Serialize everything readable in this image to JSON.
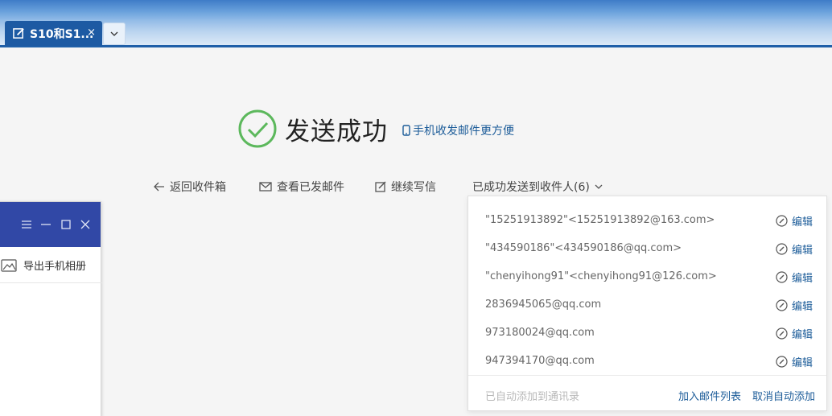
{
  "tab": {
    "title": "S10和S1...",
    "close": "×"
  },
  "success": {
    "title": "发送成功",
    "mobile_link": "手机收发邮件更方便"
  },
  "actions": {
    "back": "返回收件箱",
    "view_sent": "查看已发邮件",
    "continue": "继续写信",
    "recipients": "已成功发送到收件人(6)"
  },
  "recipients": [
    {
      "address": "\"15251913892\"<15251913892@163.com>",
      "edit": "编辑"
    },
    {
      "address": "\"434590186\"<434590186@qq.com>",
      "edit": "编辑"
    },
    {
      "address": "\"chenyihong91\"<chenyihong91@126.com>",
      "edit": "编辑"
    },
    {
      "address": "2836945065@qq.com",
      "edit": "编辑"
    },
    {
      "address": "973180024@qq.com",
      "edit": "编辑"
    },
    {
      "address": "947394170@qq.com",
      "edit": "编辑"
    }
  ],
  "footer": {
    "note": "已自动添加到通讯录",
    "add_list": "加入邮件列表",
    "cancel": "取消自动添加"
  },
  "float_window": {
    "item": "导出手机相册"
  },
  "colors": {
    "brand": "#1d5aa3",
    "link": "#1c5c99",
    "success": "#5cb85c",
    "window_header": "#3148a6"
  }
}
